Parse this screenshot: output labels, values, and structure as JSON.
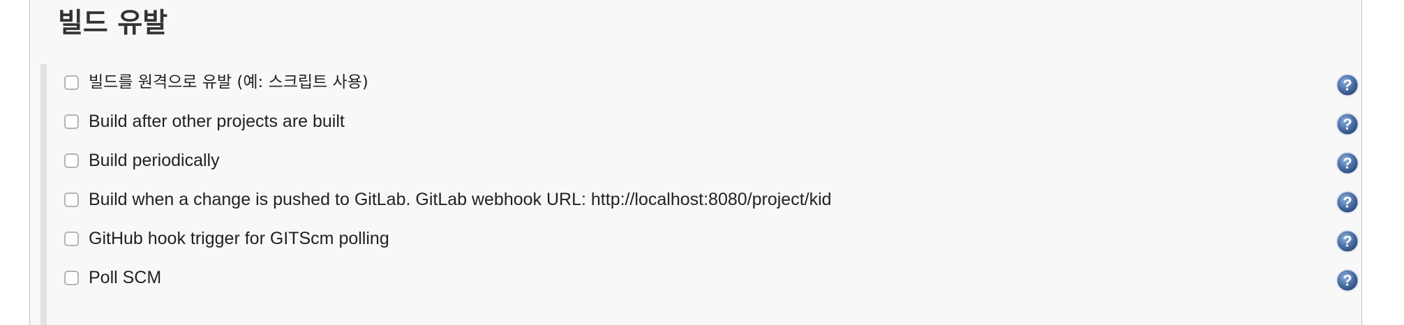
{
  "section": {
    "title": "빌드 유발"
  },
  "options": [
    {
      "label": "빌드를 원격으로 유발 (예: 스크립트 사용)",
      "checked": false,
      "help_icon": "help-icon"
    },
    {
      "label": "Build after other projects are built",
      "checked": false,
      "help_icon": "help-icon"
    },
    {
      "label": "Build periodically",
      "checked": false,
      "help_icon": "help-icon"
    },
    {
      "label": "Build when a change is pushed to GitLab. GitLab webhook URL: http://localhost:8080/project/kid",
      "checked": false,
      "help_icon": "help-icon"
    },
    {
      "label": "GitHub hook trigger for GITScm polling",
      "checked": false,
      "help_icon": "help-icon"
    },
    {
      "label": "Poll SCM",
      "checked": false,
      "help_icon": "help-icon"
    }
  ],
  "colors": {
    "panel_background": "#f8f8f8",
    "help_icon_fill": "#4a6fa5",
    "checkbox_border": "#b4b4b4"
  }
}
